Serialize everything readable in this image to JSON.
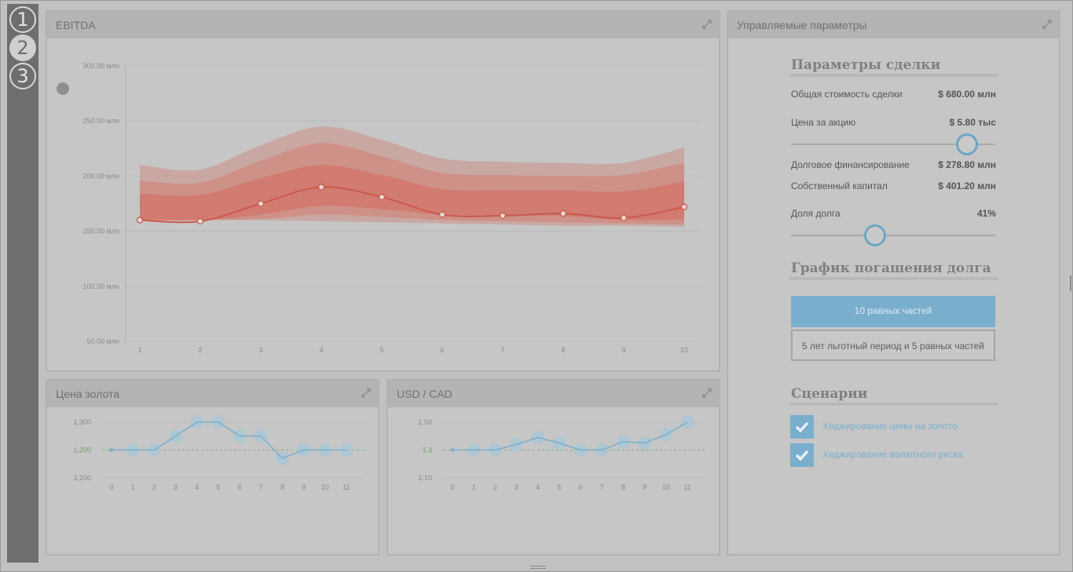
{
  "steps": [
    "1",
    "2",
    "3"
  ],
  "panels": {
    "ebitda": {
      "title": "EBITDA"
    },
    "gold": {
      "title": "Цена золота"
    },
    "usdcad": {
      "title": "USD / CAD"
    },
    "params": {
      "title": "Управляемые параметры"
    }
  },
  "params": {
    "deal_title": "Параметры сделки",
    "total_label": "Общая стоимость сделки",
    "total_value": "$ 680.00 млн",
    "price_label": "Цена за акцию",
    "price_value": "$ 5.80 тыс",
    "price_slider_level": 0.86,
    "debt_label": "Долговое финансирование",
    "debt_value": "$ 278.80 млн",
    "equity_label": "Собственный капитал",
    "equity_value": "$ 401.20 млн",
    "debt_share_label": "Доля долга",
    "debt_share_value": "41%",
    "debt_share_level": 0.41,
    "repay_title": "График погашения долга",
    "repay_option1": "10 равных частей",
    "repay_option2": "5 лет льготный период и 5 равных частей",
    "scenarios_title": "Сценарии",
    "scenario1": "Хеджирование цены на золото",
    "scenario2": "Хеджирование валютного риска"
  },
  "colors": {
    "accent": "#79afcd",
    "ebitda_line": "#c85a4c",
    "band_outer": "#c9a29d",
    "band_mid": "#cf8d84",
    "band_inner": "#d2776c",
    "gold_baseline": "#7ab17a"
  },
  "icons": {
    "expand": "expand-arrows-icon",
    "check": "checkmark-icon"
  },
  "chart_data": [
    {
      "type": "area",
      "title": "EBITDA",
      "x": [
        1,
        2,
        3,
        4,
        5,
        6,
        7,
        8,
        9,
        10
      ],
      "ylim": [
        50,
        300
      ],
      "yticks": [
        "300.00 млн",
        "250.00 млн",
        "200.00 млн",
        "150.00 млн",
        "100.00 млн",
        "50.00 млн"
      ],
      "ytick_values": [
        300,
        250,
        200,
        150,
        100,
        50
      ],
      "series": [
        {
          "values": [
            160,
            159,
            175,
            190,
            181,
            165,
            164,
            166,
            162,
            172
          ]
        }
      ],
      "bands": [
        {
          "upper": [
            210,
            206,
            228,
            245,
            233,
            216,
            213,
            212,
            212,
            226
          ],
          "lower": [
            160,
            160,
            160,
            159,
            158,
            157,
            156,
            155,
            155,
            154
          ]
        },
        {
          "upper": [
            196,
            194,
            214,
            230,
            218,
            203,
            201,
            200,
            201,
            212
          ],
          "lower": [
            160,
            160,
            161,
            165,
            163,
            160,
            159,
            158,
            157,
            156
          ]
        },
        {
          "upper": [
            184,
            183,
            198,
            210,
            201,
            188,
            187,
            187,
            186,
            195
          ],
          "lower": [
            160,
            160,
            165,
            173,
            170,
            165,
            164,
            164,
            160,
            161
          ]
        }
      ],
      "grid": true
    },
    {
      "type": "line",
      "title": "Цена золота",
      "x": [
        0,
        1,
        2,
        3,
        4,
        5,
        6,
        7,
        8,
        9,
        10,
        11
      ],
      "ylim": [
        1100,
        1300
      ],
      "yticks": [
        "1,300",
        "1,200",
        "1,100"
      ],
      "ytick_values": [
        1300,
        1200,
        1100
      ],
      "baseline": 1200,
      "series": [
        {
          "values": [
            1200,
            1200,
            1200,
            1250,
            1300,
            1300,
            1250,
            1250,
            1170,
            1200,
            1200,
            1200
          ]
        }
      ],
      "grid": true
    },
    {
      "type": "line",
      "title": "USD / CAD",
      "x": [
        0,
        1,
        2,
        3,
        4,
        5,
        6,
        7,
        8,
        9,
        10,
        11
      ],
      "ylim": [
        1.1,
        1.5
      ],
      "yticks": [
        "1.50",
        "1.3",
        "1.10"
      ],
      "ytick_values": [
        1.5,
        1.3,
        1.1
      ],
      "baseline": 1.3,
      "series": [
        {
          "values": [
            1.3,
            1.3,
            1.3,
            1.34,
            1.39,
            1.35,
            1.3,
            1.3,
            1.36,
            1.35,
            1.41,
            1.5
          ]
        }
      ],
      "grid": true
    }
  ]
}
